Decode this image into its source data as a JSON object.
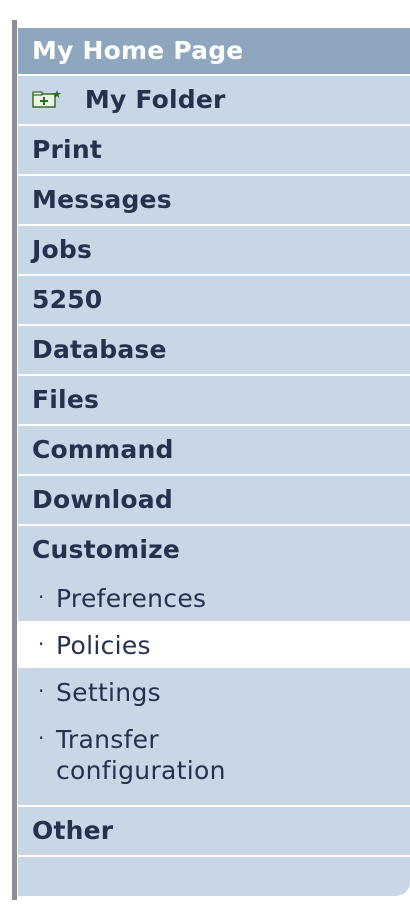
{
  "nav": {
    "header": "My Home Page",
    "items": [
      {
        "label": "My Folder"
      },
      {
        "label": "Print"
      },
      {
        "label": "Messages"
      },
      {
        "label": "Jobs"
      },
      {
        "label": "5250"
      },
      {
        "label": "Database"
      },
      {
        "label": "Files"
      },
      {
        "label": "Command"
      },
      {
        "label": "Download"
      },
      {
        "label": "Customize"
      }
    ],
    "customize_sub": [
      {
        "label": "Preferences"
      },
      {
        "label": "Policies",
        "active": true
      },
      {
        "label": "Settings"
      },
      {
        "label": "Transfer",
        "label2": "configuration"
      }
    ],
    "after_items": [
      {
        "label": "Other"
      }
    ],
    "bullet": "·"
  },
  "colors": {
    "nav_bg": "#c8d6e6",
    "header_bg": "#8fa6bf",
    "text": "#25314e",
    "active_bg": "#ffffff"
  },
  "icons": {
    "my_folder": "folder-add-icon"
  }
}
